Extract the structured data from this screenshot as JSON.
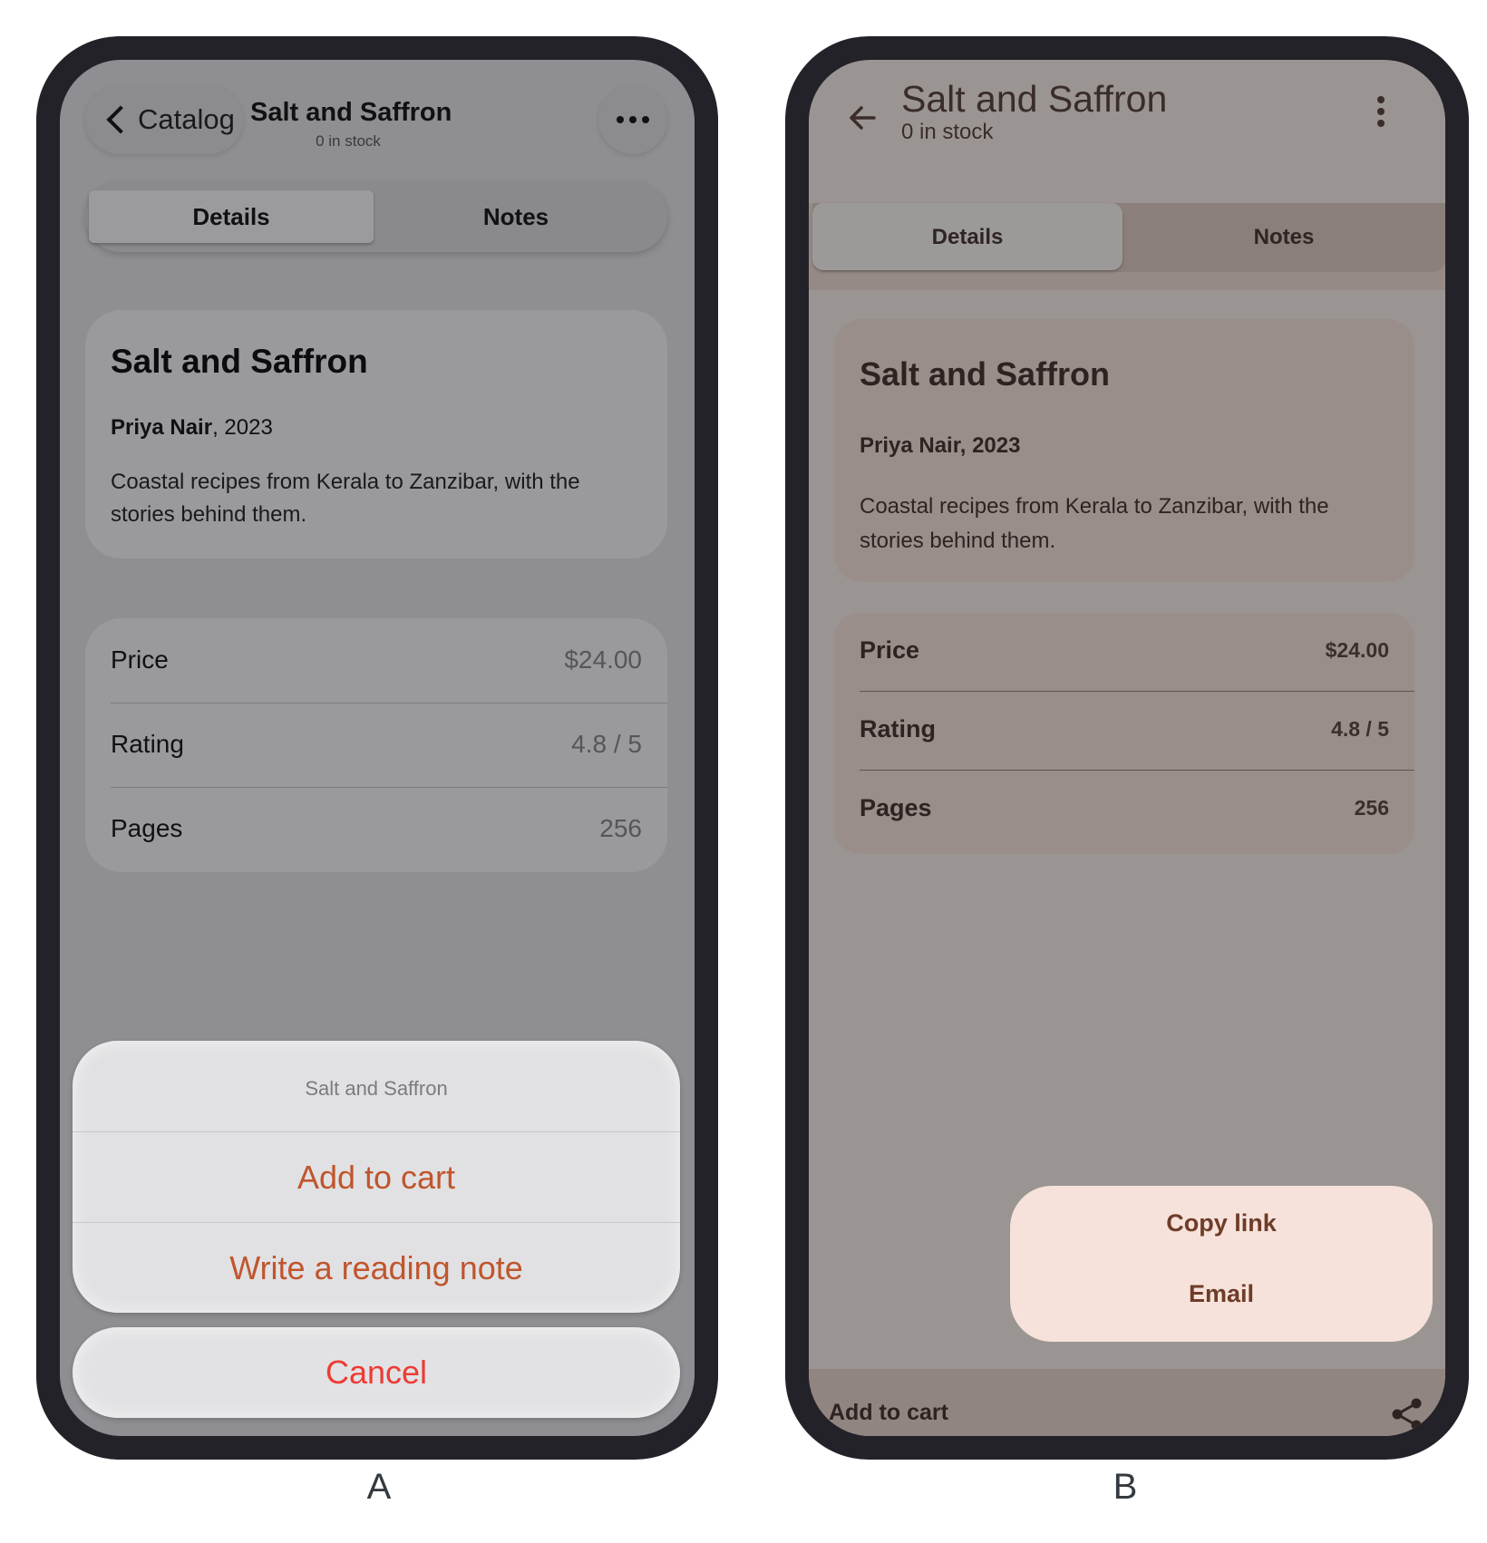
{
  "phone_a": {
    "caption": "A",
    "nav": {
      "back_label": "Catalog",
      "title": "Salt and Saffron",
      "subtitle": "0 in stock"
    },
    "tabs": [
      {
        "label": "Details",
        "selected": true
      },
      {
        "label": "Notes",
        "selected": false
      }
    ],
    "card": {
      "title": "Salt and Saffron",
      "author": "Priya Nair",
      "year": ", 2023",
      "description": "Coastal recipes from Kerala to Zanzibar, with the stories behind them."
    },
    "rows": [
      {
        "label": "Price",
        "value": "$24.00"
      },
      {
        "label": "Rating",
        "value": "4.8 / 5"
      },
      {
        "label": "Pages",
        "value": "256"
      }
    ],
    "action_sheet": {
      "title": "Salt and Saffron",
      "actions": [
        "Add to cart",
        "Write a reading note"
      ],
      "cancel": "Cancel"
    }
  },
  "phone_b": {
    "caption": "B",
    "appbar": {
      "title": "Salt and Saffron",
      "subtitle": "0 in stock"
    },
    "tabs": [
      {
        "label": "Details",
        "selected": true
      },
      {
        "label": "Notes",
        "selected": false
      }
    ],
    "card": {
      "title": "Salt and Saffron",
      "author_year": "Priya Nair, 2023",
      "description": "Coastal recipes from Kerala to Zanzibar, with the stories behind them."
    },
    "rows": [
      {
        "label": "Price",
        "value": "$24.00"
      },
      {
        "label": "Rating",
        "value": "4.8 / 5"
      },
      {
        "label": "Pages",
        "value": "256"
      }
    ],
    "menu": [
      "Copy link",
      "Email"
    ],
    "bottom_bar": {
      "label": "Add to cart"
    },
    "icons": {
      "back": "arrow-back-icon",
      "more": "more-vert-icon",
      "share": "share-icon"
    }
  },
  "colors": {
    "a_action": "#c0552d",
    "a_cancel": "#ee3b34",
    "b_menu_bg": "#f6e2da",
    "b_menu_text": "#6e3c28"
  }
}
